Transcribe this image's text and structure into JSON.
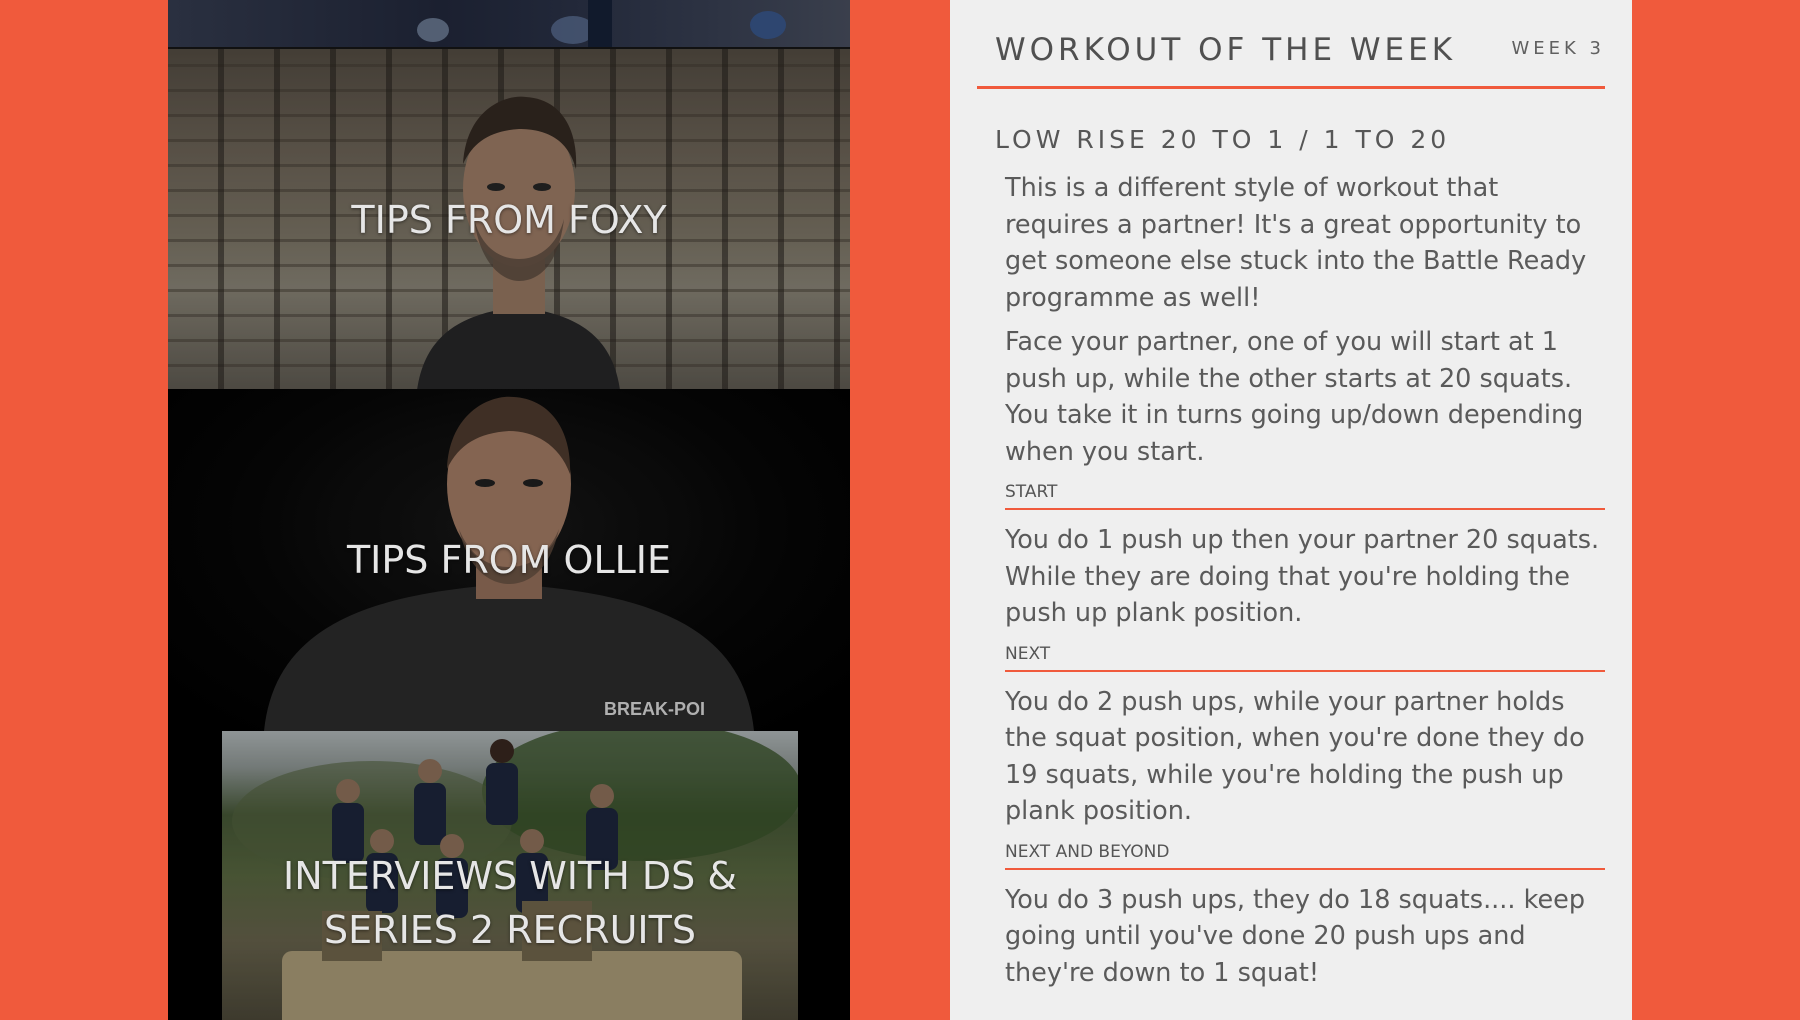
{
  "tiles": {
    "foxy": "TIPS FROM FOXY",
    "ollie": "TIPS FROM OLLIE",
    "interviews": "INTERVIEWS WITH DS & SERIES 2 RECRUITS",
    "shirt_brand": "BREAK-POI"
  },
  "card": {
    "title": "WORKOUT OF THE WEEK",
    "week": "WEEK 3",
    "workout_name": "LOW RISE 20 TO 1 / 1 TO 20",
    "intro": [
      "This is a different style of workout that requires a partner! It's a great opportunity to get someone else stuck into the Battle Ready programme as well!",
      "Face your partner, one of you will start at 1 push up, while the other starts at 20 squats. You take it in turns going up/down depending when you start."
    ],
    "sections": [
      {
        "label": "START",
        "text": "You do 1 push up then your partner 20 squats. While they are doing that you're holding the push up plank position."
      },
      {
        "label": "NEXT",
        "text": "You do 2 push ups, while your partner holds the squat position, when you're done they do 19 squats, while you're holding the push up plank position."
      },
      {
        "label": "NEXT AND BEYOND",
        "text": "You do 3 push ups, they do 18 squats.... keep going until you've done 20 push ups and they're down to 1 squat!"
      }
    ]
  },
  "colors": {
    "accent": "#f05a3c",
    "card_bg": "#efefef",
    "text": "#5a5a5a"
  }
}
